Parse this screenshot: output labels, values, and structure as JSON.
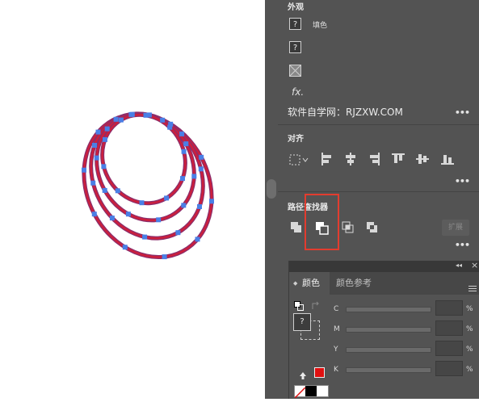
{
  "appearance": {
    "title": "外观",
    "fill_label": "填色",
    "unknown_glyph": "?",
    "fx_label": "fx."
  },
  "watermark": "软件自学网：RJZXW.COM",
  "align": {
    "title": "对齐"
  },
  "pathfinder": {
    "title": "路径查找器",
    "expand_label": "扩展"
  },
  "color_panel": {
    "tab_active": "颜色",
    "tab_inactive": "颜色参考",
    "collapse_glyph": "◂◂",
    "close_glyph": "×",
    "tab_arrow": "◆",
    "unknown_glyph": "?",
    "channels": [
      {
        "label": "C",
        "unit": "%"
      },
      {
        "label": "M",
        "unit": "%"
      },
      {
        "label": "Y",
        "unit": "%"
      },
      {
        "label": "K",
        "unit": "%"
      }
    ]
  },
  "colors": {
    "panel_bg": "#535353",
    "path_stroke": "#8b2d6b",
    "path_fill": "#cc1f3c",
    "anchor": "#4a7fe6",
    "highlight": "#e23c2f",
    "out_of_gamut": "#e01010"
  }
}
